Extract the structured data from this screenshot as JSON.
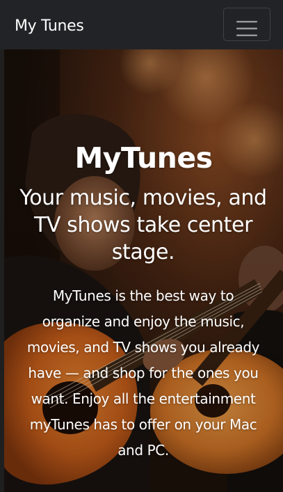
{
  "navbar": {
    "brand": "My Tunes",
    "toggler_icon": "hamburger-menu-icon"
  },
  "hero": {
    "background_image": "guitarists-playing-acoustic-guitars",
    "title": "MyTunes",
    "subtitle": "Your music, movies, and TV shows take center stage.",
    "text": "MyTunes is the best way to organize and enjoy the music, movies, and TV shows you already have — and shop for the ones you want. Enjoy all the entertainment myTunes has to offer on your Mac and PC."
  },
  "colors": {
    "navbar_bg": "#222326",
    "text": "#ffffff",
    "guitar_orange": "#d2631b"
  }
}
